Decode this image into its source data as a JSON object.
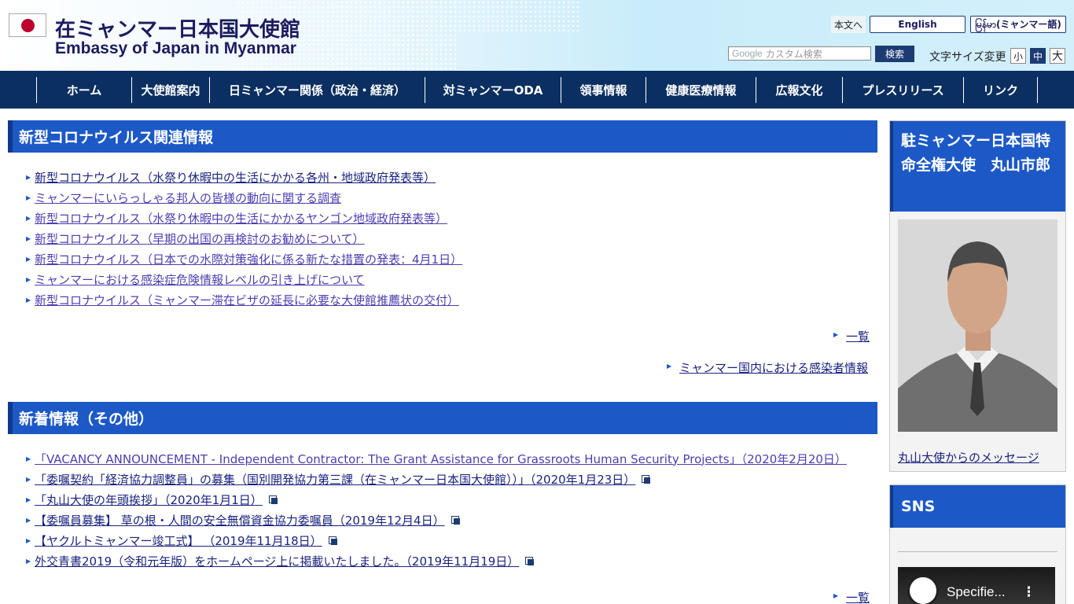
{
  "header": {
    "title_ja": "在ミャンマー日本国大使館",
    "title_en": "Embassy of Japan in Myanmar",
    "skip_label": "本文へ",
    "lang_en": "English",
    "lang_my": "မြန်မာ(ミャンマー語)",
    "search_google": "Google",
    "search_placeholder": "カスタム検索",
    "search_button": "検索",
    "fontsize_label": "文字サイズ変更",
    "fs_small": "小",
    "fs_medium": "中",
    "fs_large": "大"
  },
  "nav": {
    "items": [
      {
        "label": "ホーム"
      },
      {
        "label": "大使館案内"
      },
      {
        "label": "日ミャンマー関係（政治・経済）"
      },
      {
        "label": "対ミャンマーODA"
      },
      {
        "label": "領事情報"
      },
      {
        "label": "健康医療情報"
      },
      {
        "label": "広報文化"
      },
      {
        "label": "プレスリリース"
      },
      {
        "label": "リンク"
      }
    ]
  },
  "covid": {
    "title": "新型コロナウイルス関連情報",
    "items": [
      {
        "text": "新型コロナウイルス（水祭り休暇中の生活にかかる各州・地域政府発表等）"
      },
      {
        "text": "ミャンマーにいらっしゃる邦人の皆様の動向に関する調査"
      },
      {
        "text": "新型コロナウイルス（水祭り休暇中の生活にかかるヤンゴン地域政府発表等）"
      },
      {
        "text": "新型コロナウイルス（早期の出国の再検討のお勧めについて）"
      },
      {
        "text": "新型コロナウイルス（日本での水際対策強化に係る新たな措置の発表：4月1日）"
      },
      {
        "text": "ミャンマーにおける感染症危険情報レベルの引き上げについて"
      },
      {
        "text": "新型コロナウイルス（ミャンマー滞在ビザの延長に必要な大使館推薦状の交付）"
      }
    ],
    "more_label": "一覧",
    "infection_link": "ミャンマー国内における感染者情報"
  },
  "news": {
    "title": "新着情報（その他）",
    "items": [
      {
        "text": "「VACANCY ANNOUNCEMENT - Independent Contractor: The Grant Assistance for Grassroots Human Security Projects」（2020年2月20日）"
      },
      {
        "text": "「委嘱契約「経済協力調整員」の募集（国別開発協力第三課（在ミャンマー日本国大使館））」（2020年1月23日）"
      },
      {
        "text": "「丸山大使の年頭挨拶」（2020年1月1日）"
      },
      {
        "text": "【委嘱員募集】 草の根・人間の安全無償資金協力委嘱員（2019年12月4日）"
      },
      {
        "text": "【ヤクルトミャンマー竣工式】 （2019年11月18日）"
      },
      {
        "text": "外交青書2019（令和元年版）をホームページ上に掲載いたしました。（2019年11月19日）"
      }
    ],
    "more_label": "一覧"
  },
  "sidebar": {
    "ambassador_title": "駐ミャンマー日本国特命全権大使　丸山市郎",
    "ambassador_link": "丸山大使からのメッセージ",
    "sns_title": "SNS",
    "video_title": "Specifie..."
  }
}
